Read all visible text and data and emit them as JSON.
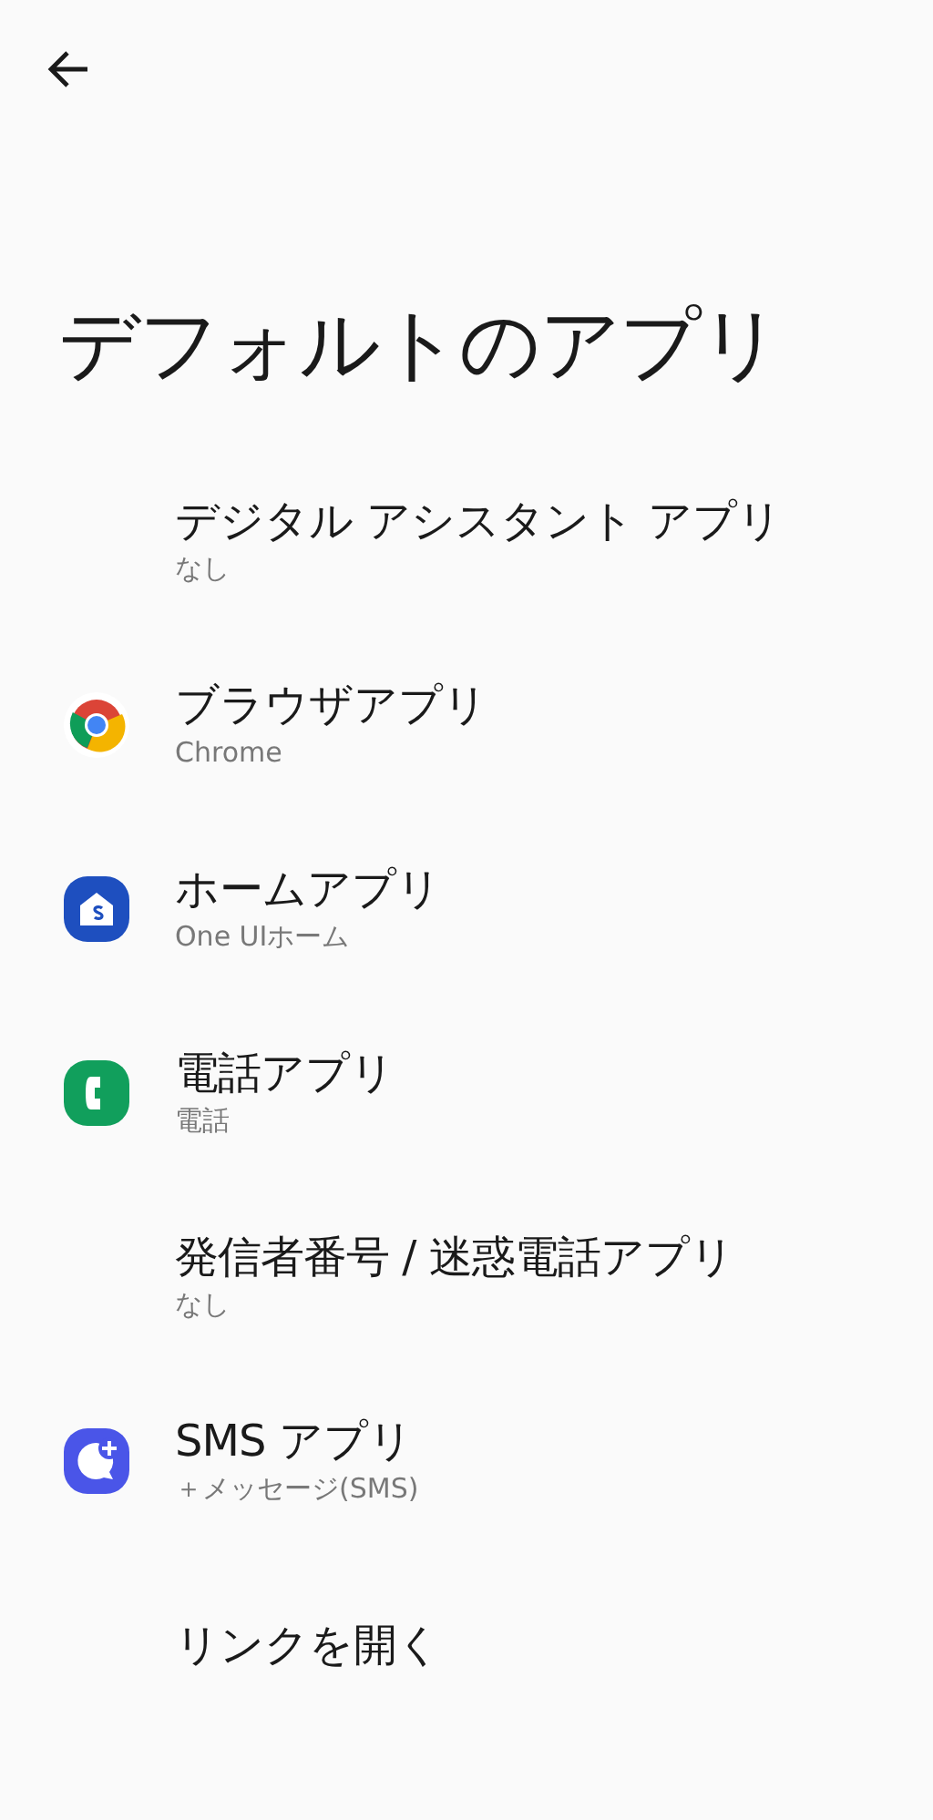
{
  "title": "デフォルトのアプリ",
  "items": [
    {
      "kind": "plain",
      "label": "デジタル アシスタント アプリ",
      "value": "なし"
    },
    {
      "kind": "browser",
      "label": "ブラウザアプリ",
      "value": "Chrome"
    },
    {
      "kind": "home",
      "label": "ホームアプリ",
      "value": "One UIホーム"
    },
    {
      "kind": "phone",
      "label": "電話アプリ",
      "value": "電話"
    },
    {
      "kind": "plain",
      "label": "発信者番号 / 迷惑電話アプリ",
      "value": "なし"
    },
    {
      "kind": "messages",
      "label": "SMS アプリ",
      "value": "＋メッセージ(SMS)"
    },
    {
      "kind": "plain",
      "label": "リンクを開く"
    }
  ]
}
